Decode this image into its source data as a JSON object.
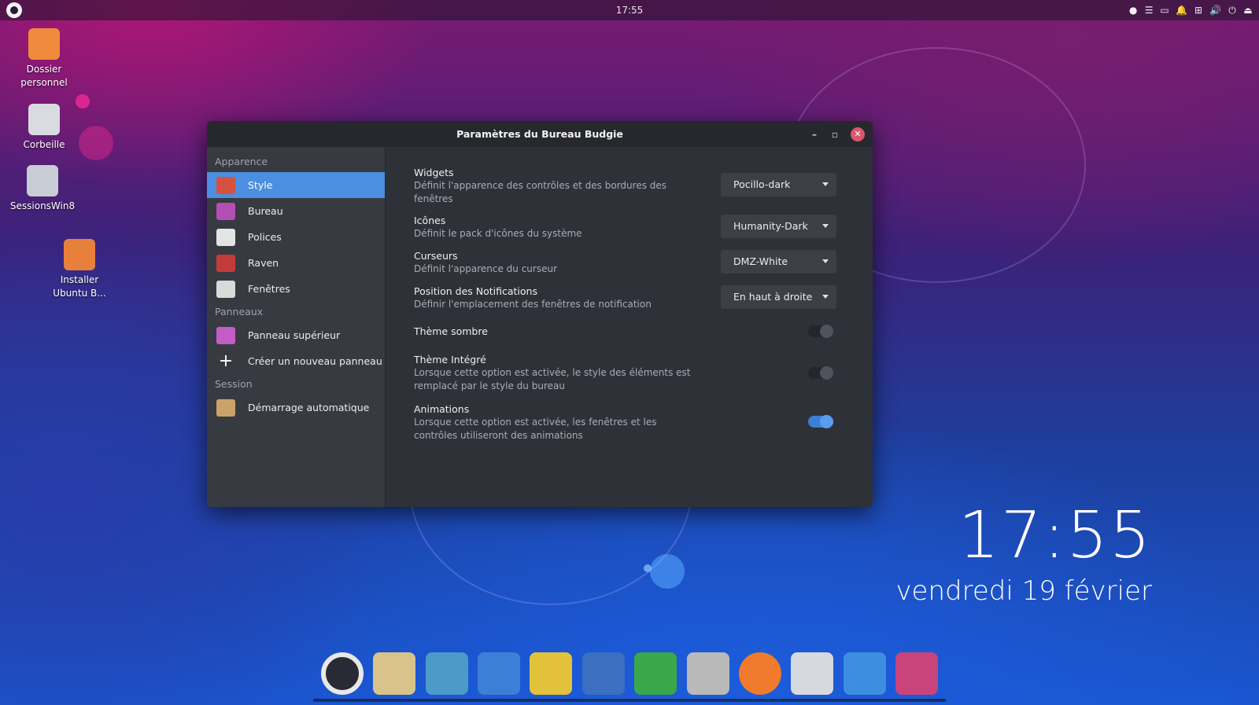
{
  "top_panel": {
    "clock": "17:55",
    "tray": [
      "●",
      "☰",
      "▭",
      "🔔",
      "⊞",
      "🔊",
      "⏻",
      "⏏"
    ]
  },
  "desktop_icons": [
    {
      "label": "Dossier personnel",
      "icon": "home-folder-icon",
      "color": "#f08a3c"
    },
    {
      "label": "Corbeille",
      "icon": "trash-icon",
      "color": "#d8dbe0"
    },
    {
      "label": "SessionsWin8",
      "icon": "drive-icon",
      "color": "#c8ccd4"
    },
    {
      "label": "Installer Ubuntu B...",
      "icon": "installer-icon",
      "color": "#e6803a"
    }
  ],
  "window": {
    "title": "Paramètres du Bureau Budgie",
    "controls": {
      "minimize": "–",
      "maximize": "▫",
      "close": "✕"
    },
    "sidebar": {
      "sections": [
        {
          "label": "Apparence",
          "items": [
            {
              "label": "Style",
              "icon": "style-icon",
              "color": "#d4523f",
              "active": true
            },
            {
              "label": "Bureau",
              "icon": "desktop-icon",
              "color": "#b24eb4",
              "active": false
            },
            {
              "label": "Polices",
              "icon": "fonts-icon",
              "color": "#e4e4e4",
              "active": false
            },
            {
              "label": "Raven",
              "icon": "raven-icon",
              "color": "#c23b3b",
              "active": false
            },
            {
              "label": "Fenêtres",
              "icon": "windows-icon",
              "color": "#dadada",
              "active": false
            }
          ]
        },
        {
          "label": "Panneaux",
          "items": [
            {
              "label": "Panneau supérieur",
              "icon": "top-panel-icon",
              "color": "#c45cc6",
              "active": false
            },
            {
              "label": "Créer un nouveau panneau",
              "icon": "plus-icon",
              "color": "transparent",
              "active": false
            }
          ]
        },
        {
          "label": "Session",
          "items": [
            {
              "label": "Démarrage automatique",
              "icon": "autostart-icon",
              "color": "#c9a36a",
              "active": false
            }
          ]
        }
      ]
    },
    "settings": {
      "widgets": {
        "title": "Widgets",
        "desc": "Définit l'apparence des contrôles et des bordures des",
        "desc2": "fenêtres",
        "value": "Pocillo-dark"
      },
      "icons": {
        "title": "Icônes",
        "desc": "Définit le pack d'icônes du système",
        "value": "Humanity-Dark"
      },
      "cursors": {
        "title": "Curseurs",
        "desc": "Définit l'apparence du curseur",
        "value": "DMZ-White"
      },
      "notifications": {
        "title": "Position des Notifications",
        "desc": "Définir l'emplacement des fenêtres de notification",
        "value": "En haut à droite"
      },
      "dark_theme": {
        "title": "Thème sombre",
        "enabled": false
      },
      "integrated_theme": {
        "title": "Thème Intégré",
        "desc": "Lorsque cette option est activée, le style des éléments est",
        "desc2": "remplacé par le style du bureau",
        "enabled": false
      },
      "animations": {
        "title": "Animations",
        "desc": "Lorsque cette option est activée, les fenêtres et les",
        "desc2": "contrôles utiliseront des animations",
        "enabled": true
      }
    }
  },
  "desktop_clock": {
    "time": "17:55",
    "date": "vendredi 19 février"
  },
  "dock": [
    {
      "icon": "budgie-menu-icon",
      "color": "#e8e8e8"
    },
    {
      "icon": "system-monitor-icon",
      "color": "#d9c38a"
    },
    {
      "icon": "screenshot-icon",
      "color": "#4c9ac8"
    },
    {
      "icon": "software-store-icon",
      "color": "#3d7fd6"
    },
    {
      "icon": "rhythmbox-icon",
      "color": "#e2c23a"
    },
    {
      "icon": "writer-icon",
      "color": "#3b6fbf"
    },
    {
      "icon": "calc-icon",
      "color": "#3aa84a"
    },
    {
      "icon": "file-manager-icon",
      "color": "#b9b9b9"
    },
    {
      "icon": "firefox-icon",
      "color": "#f07b2c"
    },
    {
      "icon": "dock-trash-icon",
      "color": "#d6d9de"
    },
    {
      "icon": "anchor-icon",
      "color": "#3d8ee0"
    },
    {
      "icon": "tweaks-icon",
      "color": "#c8447a"
    }
  ]
}
